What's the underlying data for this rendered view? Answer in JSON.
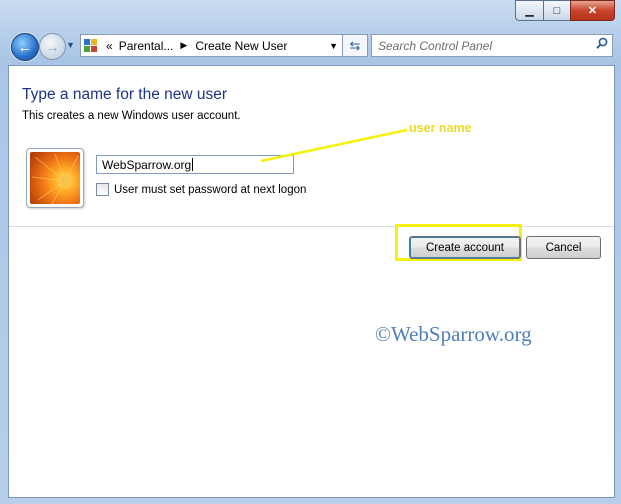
{
  "navigation": {
    "breadcrumb": [
      "Parental...",
      "Create New User"
    ],
    "breadcrumb_prefix": "«",
    "search_placeholder": "Search Control Panel"
  },
  "dialog": {
    "title": "Type a name for the new user",
    "subtitle": "This creates a new Windows user account.",
    "username_value": "WebSparrow.org",
    "checkbox_label": "User must set password at next logon",
    "checkbox_checked": false,
    "create_button": "Create account",
    "cancel_button": "Cancel"
  },
  "annotation": {
    "label": "user name",
    "color": "#f4f20a"
  },
  "watermark": "©WebSparrow.org",
  "icons": {
    "back": "back-arrow-icon",
    "forward": "forward-arrow-icon",
    "control_panel": "control-panel-icon",
    "refresh": "refresh-icon",
    "search": "search-icon",
    "user_picture": "flower-avatar-icon"
  }
}
